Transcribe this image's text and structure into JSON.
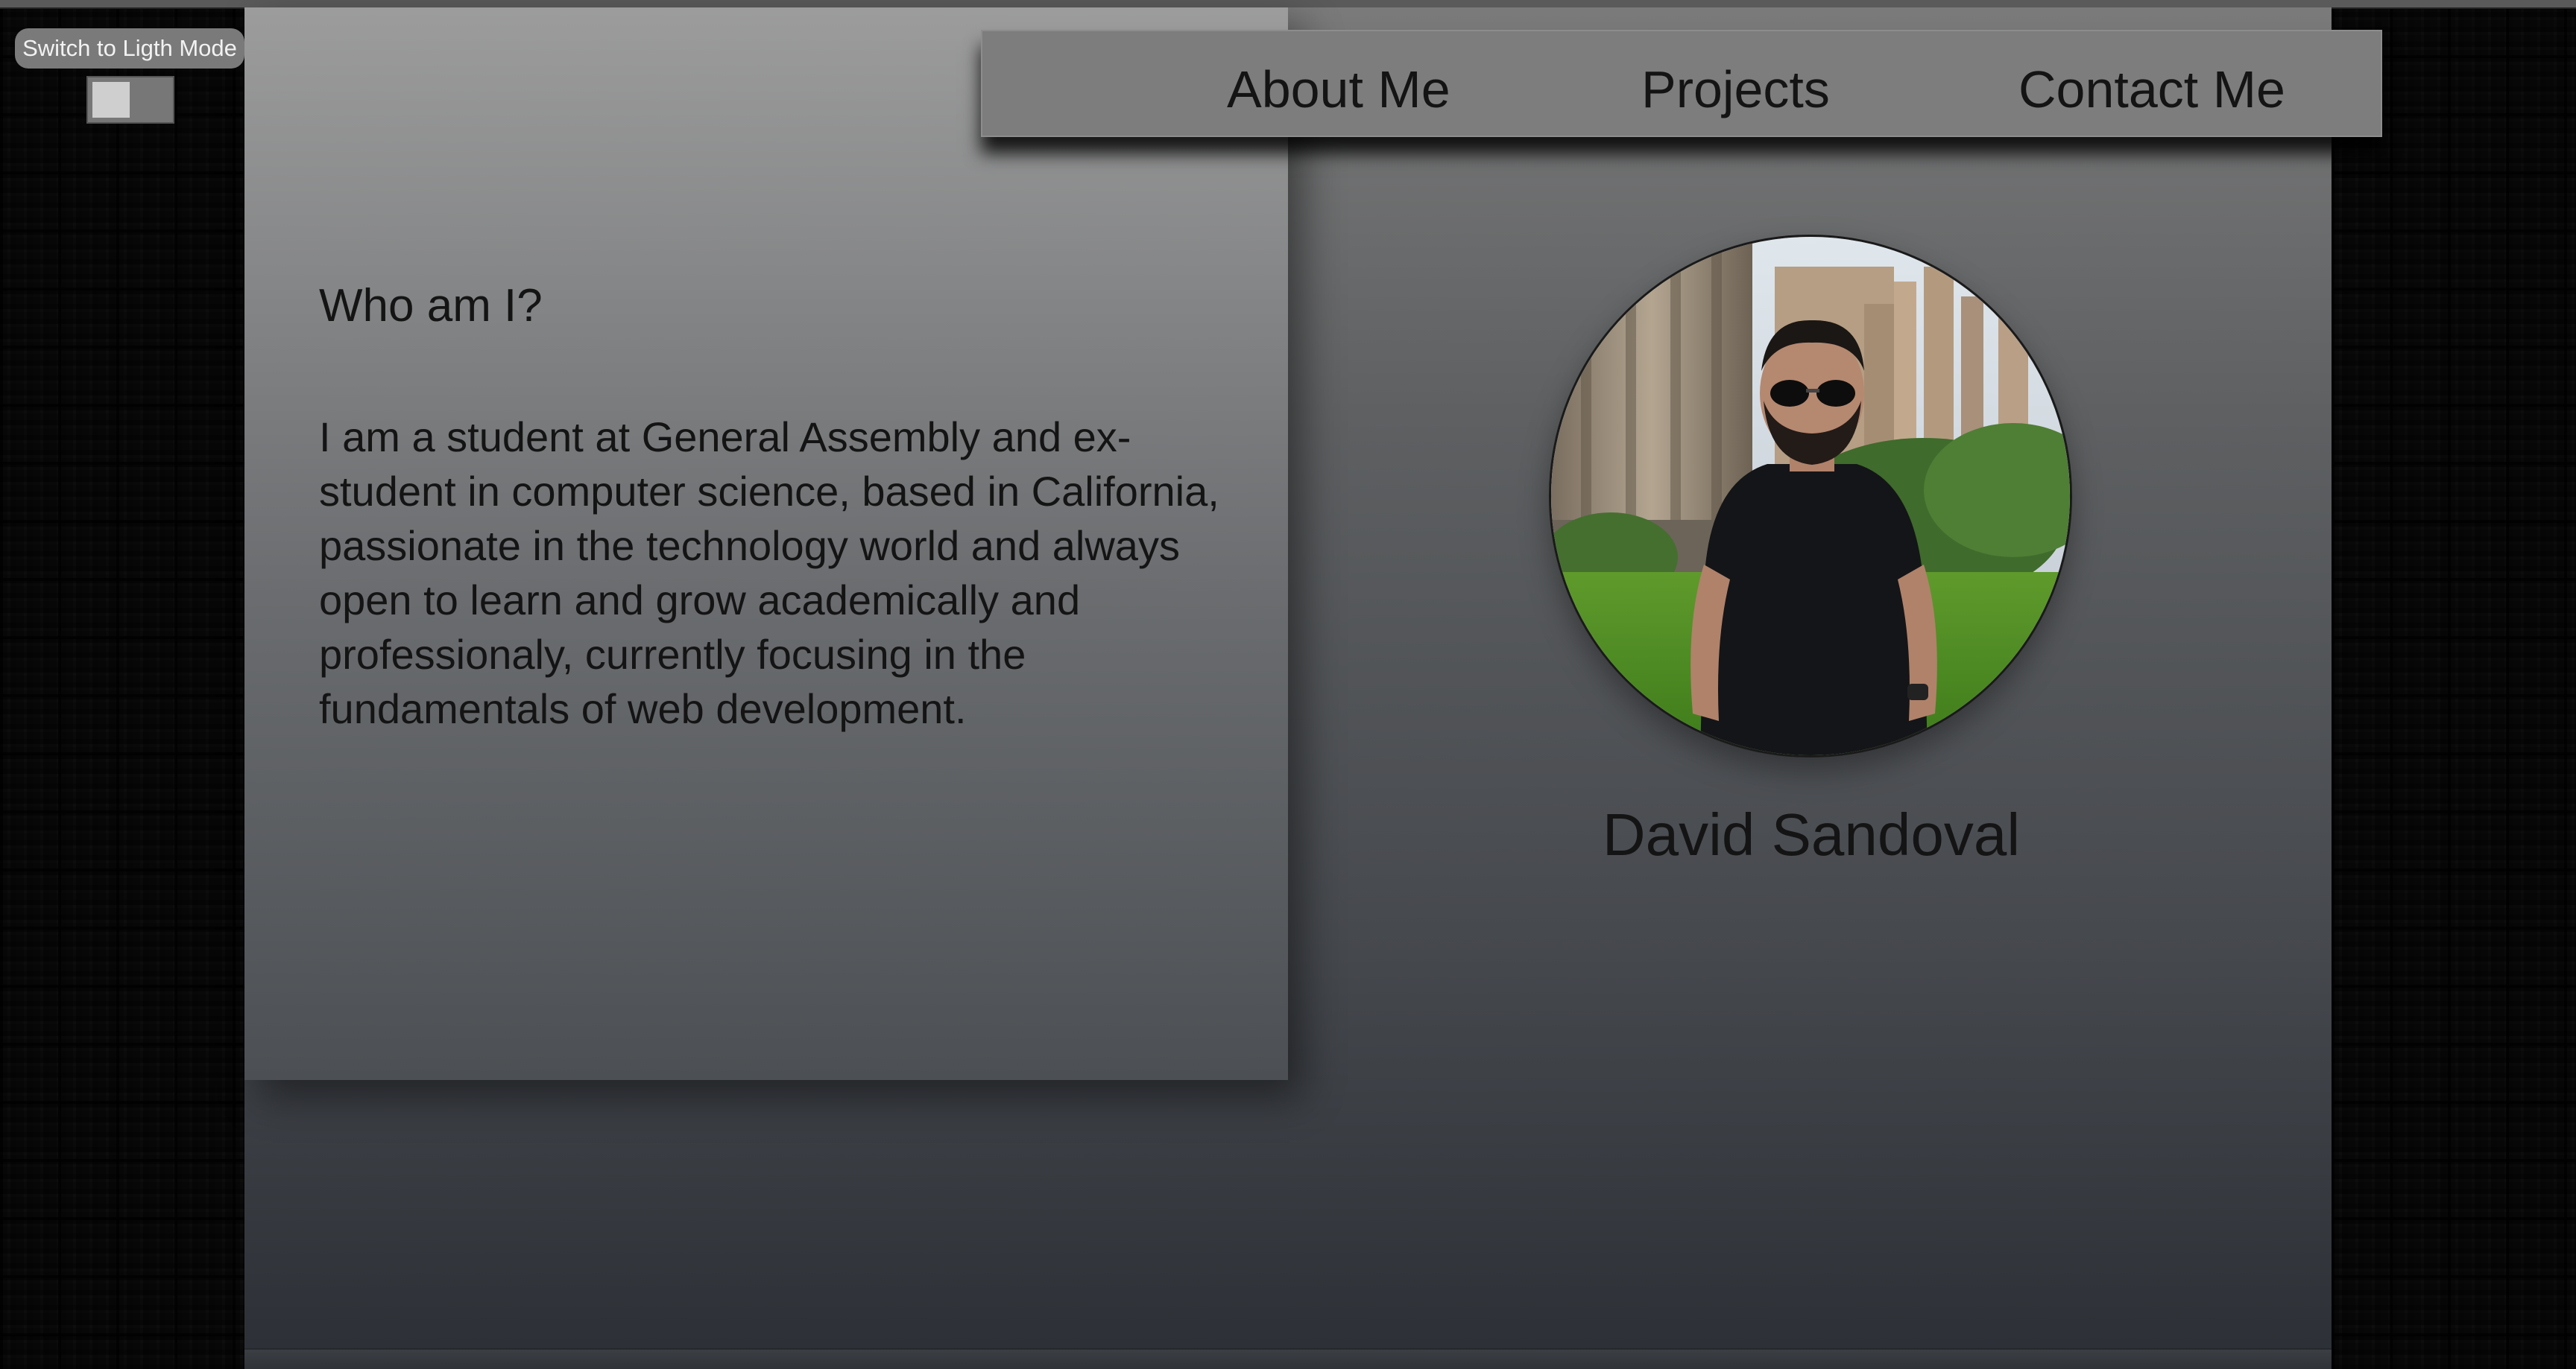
{
  "theme_toggle": {
    "label": "Switch to Ligth Mode"
  },
  "nav": {
    "items": [
      {
        "label": "About Me"
      },
      {
        "label": "Projects"
      },
      {
        "label": "Contact Me"
      }
    ]
  },
  "about": {
    "title": "Who am I?",
    "text": "I am a student at General Assembly and ex-student in computer science, based in California, passionate in the technology world and always open to learn and grow academically and professionaly, currently focusing in the fundamentals of web development."
  },
  "profile": {
    "name": "David Sandoval",
    "photo": "profile-photo"
  },
  "colors": {
    "text": "#141414",
    "navbar": "#7d7d7d",
    "toggle_label_bg": "#7a7a7a"
  }
}
